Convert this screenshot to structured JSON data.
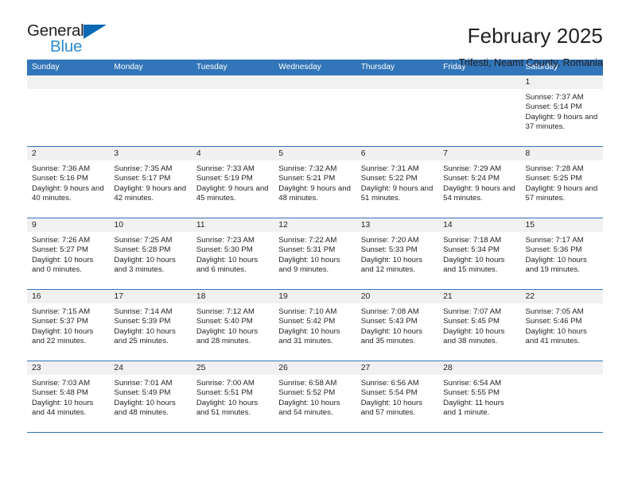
{
  "brand": {
    "name_top": "General",
    "name_bottom": "Blue",
    "triangle_color": "#0b69b4",
    "blue_text_color": "#2e8bd4"
  },
  "header": {
    "title": "February 2025",
    "subtitle": "Trifesti, Neamt County, Romania"
  },
  "theme": {
    "header_bar_color": "#3275b8",
    "date_band_color": "#f1f1f1",
    "text_color": "#231f20"
  },
  "weekdays": [
    "Sunday",
    "Monday",
    "Tuesday",
    "Wednesday",
    "Thursday",
    "Friday",
    "Saturday"
  ],
  "weeks": [
    [
      {
        "day": "",
        "empty": true
      },
      {
        "day": "",
        "empty": true
      },
      {
        "day": "",
        "empty": true
      },
      {
        "day": "",
        "empty": true
      },
      {
        "day": "",
        "empty": true
      },
      {
        "day": "",
        "empty": true
      },
      {
        "day": "1",
        "sunrise": "Sunrise: 7:37 AM",
        "sunset": "Sunset: 5:14 PM",
        "daylight": "Daylight: 9 hours and 37 minutes."
      }
    ],
    [
      {
        "day": "2",
        "sunrise": "Sunrise: 7:36 AM",
        "sunset": "Sunset: 5:16 PM",
        "daylight": "Daylight: 9 hours and 40 minutes."
      },
      {
        "day": "3",
        "sunrise": "Sunrise: 7:35 AM",
        "sunset": "Sunset: 5:17 PM",
        "daylight": "Daylight: 9 hours and 42 minutes."
      },
      {
        "day": "4",
        "sunrise": "Sunrise: 7:33 AM",
        "sunset": "Sunset: 5:19 PM",
        "daylight": "Daylight: 9 hours and 45 minutes."
      },
      {
        "day": "5",
        "sunrise": "Sunrise: 7:32 AM",
        "sunset": "Sunset: 5:21 PM",
        "daylight": "Daylight: 9 hours and 48 minutes."
      },
      {
        "day": "6",
        "sunrise": "Sunrise: 7:31 AM",
        "sunset": "Sunset: 5:22 PM",
        "daylight": "Daylight: 9 hours and 51 minutes."
      },
      {
        "day": "7",
        "sunrise": "Sunrise: 7:29 AM",
        "sunset": "Sunset: 5:24 PM",
        "daylight": "Daylight: 9 hours and 54 minutes."
      },
      {
        "day": "8",
        "sunrise": "Sunrise: 7:28 AM",
        "sunset": "Sunset: 5:25 PM",
        "daylight": "Daylight: 9 hours and 57 minutes."
      }
    ],
    [
      {
        "day": "9",
        "sunrise": "Sunrise: 7:26 AM",
        "sunset": "Sunset: 5:27 PM",
        "daylight": "Daylight: 10 hours and 0 minutes."
      },
      {
        "day": "10",
        "sunrise": "Sunrise: 7:25 AM",
        "sunset": "Sunset: 5:28 PM",
        "daylight": "Daylight: 10 hours and 3 minutes."
      },
      {
        "day": "11",
        "sunrise": "Sunrise: 7:23 AM",
        "sunset": "Sunset: 5:30 PM",
        "daylight": "Daylight: 10 hours and 6 minutes."
      },
      {
        "day": "12",
        "sunrise": "Sunrise: 7:22 AM",
        "sunset": "Sunset: 5:31 PM",
        "daylight": "Daylight: 10 hours and 9 minutes."
      },
      {
        "day": "13",
        "sunrise": "Sunrise: 7:20 AM",
        "sunset": "Sunset: 5:33 PM",
        "daylight": "Daylight: 10 hours and 12 minutes."
      },
      {
        "day": "14",
        "sunrise": "Sunrise: 7:18 AM",
        "sunset": "Sunset: 5:34 PM",
        "daylight": "Daylight: 10 hours and 15 minutes."
      },
      {
        "day": "15",
        "sunrise": "Sunrise: 7:17 AM",
        "sunset": "Sunset: 5:36 PM",
        "daylight": "Daylight: 10 hours and 19 minutes."
      }
    ],
    [
      {
        "day": "16",
        "sunrise": "Sunrise: 7:15 AM",
        "sunset": "Sunset: 5:37 PM",
        "daylight": "Daylight: 10 hours and 22 minutes."
      },
      {
        "day": "17",
        "sunrise": "Sunrise: 7:14 AM",
        "sunset": "Sunset: 5:39 PM",
        "daylight": "Daylight: 10 hours and 25 minutes."
      },
      {
        "day": "18",
        "sunrise": "Sunrise: 7:12 AM",
        "sunset": "Sunset: 5:40 PM",
        "daylight": "Daylight: 10 hours and 28 minutes."
      },
      {
        "day": "19",
        "sunrise": "Sunrise: 7:10 AM",
        "sunset": "Sunset: 5:42 PM",
        "daylight": "Daylight: 10 hours and 31 minutes."
      },
      {
        "day": "20",
        "sunrise": "Sunrise: 7:08 AM",
        "sunset": "Sunset: 5:43 PM",
        "daylight": "Daylight: 10 hours and 35 minutes."
      },
      {
        "day": "21",
        "sunrise": "Sunrise: 7:07 AM",
        "sunset": "Sunset: 5:45 PM",
        "daylight": "Daylight: 10 hours and 38 minutes."
      },
      {
        "day": "22",
        "sunrise": "Sunrise: 7:05 AM",
        "sunset": "Sunset: 5:46 PM",
        "daylight": "Daylight: 10 hours and 41 minutes."
      }
    ],
    [
      {
        "day": "23",
        "sunrise": "Sunrise: 7:03 AM",
        "sunset": "Sunset: 5:48 PM",
        "daylight": "Daylight: 10 hours and 44 minutes."
      },
      {
        "day": "24",
        "sunrise": "Sunrise: 7:01 AM",
        "sunset": "Sunset: 5:49 PM",
        "daylight": "Daylight: 10 hours and 48 minutes."
      },
      {
        "day": "25",
        "sunrise": "Sunrise: 7:00 AM",
        "sunset": "Sunset: 5:51 PM",
        "daylight": "Daylight: 10 hours and 51 minutes."
      },
      {
        "day": "26",
        "sunrise": "Sunrise: 6:58 AM",
        "sunset": "Sunset: 5:52 PM",
        "daylight": "Daylight: 10 hours and 54 minutes."
      },
      {
        "day": "27",
        "sunrise": "Sunrise: 6:56 AM",
        "sunset": "Sunset: 5:54 PM",
        "daylight": "Daylight: 10 hours and 57 minutes."
      },
      {
        "day": "28",
        "sunrise": "Sunrise: 6:54 AM",
        "sunset": "Sunset: 5:55 PM",
        "daylight": "Daylight: 11 hours and 1 minute."
      },
      {
        "day": "",
        "empty": true
      }
    ]
  ]
}
